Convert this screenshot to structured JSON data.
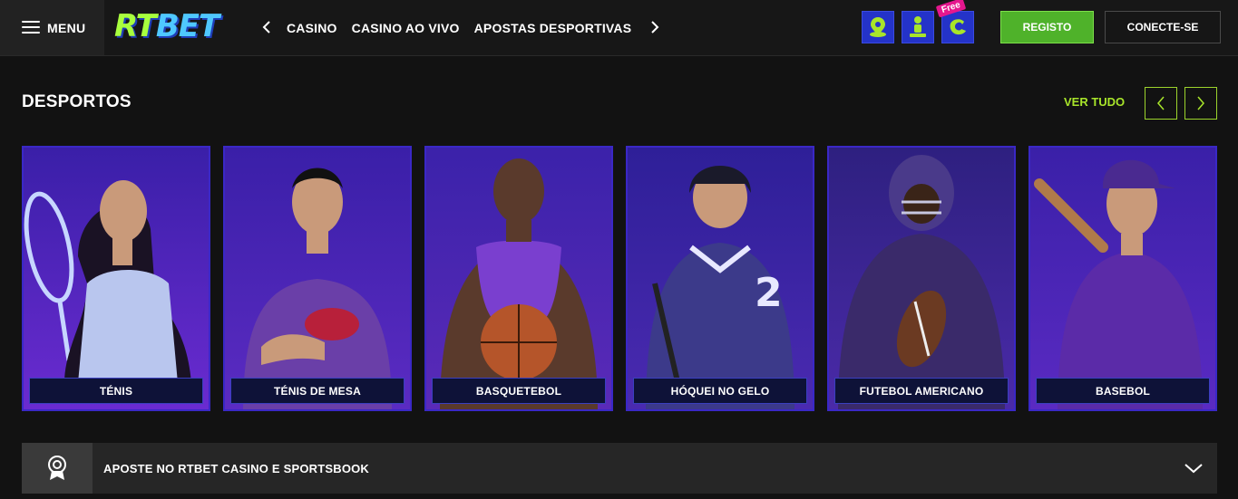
{
  "header": {
    "menu_label": "MENU",
    "logo_part1": "RT",
    "logo_part2": "BET",
    "nav": [
      "CASINO",
      "CASINO AO VIVO",
      "APOSTAS DESPORTIVAS"
    ],
    "icons": [
      "map-pin-icon",
      "user-support-icon",
      "free-coin-icon"
    ],
    "free_badge": "Free",
    "register_label": "REGISTO",
    "connect_label": "CONECTE-SE"
  },
  "section": {
    "title": "DESPORTOS",
    "view_all": "VER TUDO"
  },
  "sports": [
    {
      "label": "TÉNIS"
    },
    {
      "label": "TÉNIS DE MESA"
    },
    {
      "label": "BASQUETEBOL"
    },
    {
      "label": "HÓQUEI NO GELO"
    },
    {
      "label": "FUTEBOL AMERICANO"
    },
    {
      "label": "BASEBOL"
    }
  ],
  "accordion": {
    "title": "APOSTE NO RTBET CASINO E SPORTSBOOK"
  },
  "colors": {
    "accent_green": "#a8e52a",
    "register_green": "#4fb22a",
    "card_blue": "#2433c9",
    "card_purple": "#5b2bb8",
    "badge_pink": "#e5178e"
  }
}
